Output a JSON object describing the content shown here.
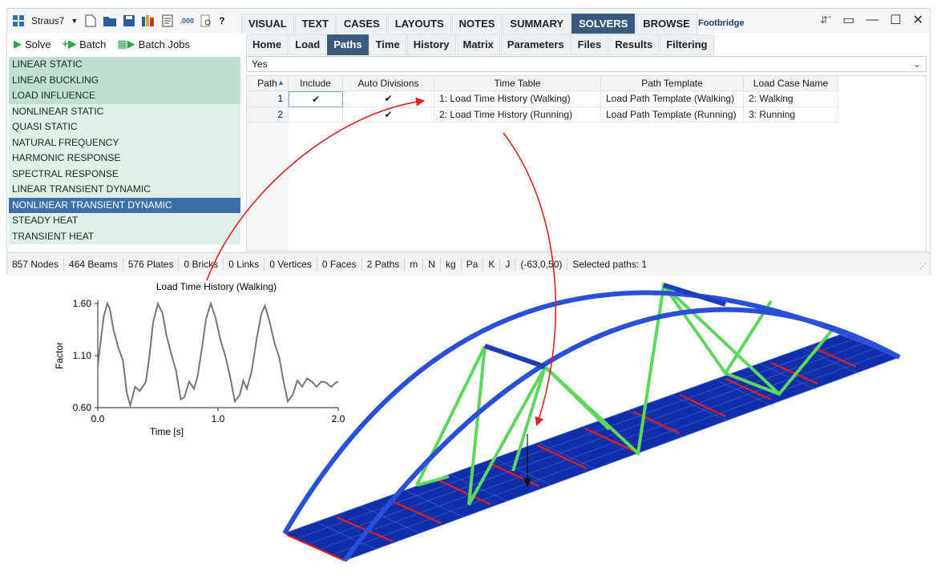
{
  "app": {
    "name": "Straus7",
    "model_title": "Footbridge"
  },
  "ribbon_tabs": [
    "VISUAL",
    "TEXT",
    "CASES",
    "LAYOUTS",
    "NOTES",
    "SUMMARY",
    "SOLVERS",
    "BROWSE"
  ],
  "ribbon_active": "SOLVERS",
  "toolbar": {
    "solve_label": "Solve",
    "batch_label": "Batch",
    "batch_jobs_label": "Batch Jobs"
  },
  "subtabs": [
    "Home",
    "Load",
    "Paths",
    "Time",
    "History",
    "Matrix",
    "Parameters",
    "Files",
    "Results",
    "Filtering"
  ],
  "subtab_active": "Paths",
  "solvers": [
    {
      "label": "LINEAR STATIC",
      "shade": "dark"
    },
    {
      "label": "LINEAR BUCKLING",
      "shade": "dark"
    },
    {
      "label": "LOAD INFLUENCE",
      "shade": "dark"
    },
    {
      "label": "NONLINEAR STATIC",
      "shade": "light"
    },
    {
      "label": "QUASI STATIC",
      "shade": "light"
    },
    {
      "label": "NATURAL FREQUENCY",
      "shade": "light"
    },
    {
      "label": "HARMONIC RESPONSE",
      "shade": "light"
    },
    {
      "label": "SPECTRAL RESPONSE",
      "shade": "light"
    },
    {
      "label": "LINEAR TRANSIENT DYNAMIC",
      "shade": "light"
    },
    {
      "label": "NONLINEAR TRANSIENT DYNAMIC",
      "shade": "selected"
    },
    {
      "label": "STEADY HEAT",
      "shade": "light"
    },
    {
      "label": "TRANSIENT HEAT",
      "shade": "light"
    }
  ],
  "dropdown_value": "Yes",
  "table": {
    "headers": [
      "Path",
      "Include",
      "Auto Divisions",
      "Time Table",
      "Path Template",
      "Load Case Name"
    ],
    "rows": [
      {
        "path": "1",
        "include": "✔",
        "auto": "✔",
        "time_table": "1: Load Time History (Walking)",
        "template": "Load Path Template (Walking)",
        "load_case": "2: Walking"
      },
      {
        "path": "2",
        "include": "",
        "auto": "✔",
        "time_table": "2: Load Time History (Running)",
        "template": "Load Path Template (Running)",
        "load_case": "3: Running"
      }
    ]
  },
  "status": [
    "857 Nodes",
    "464 Beams",
    "576 Plates",
    "0 Bricks",
    "0 Links",
    "0 Vertices",
    "0 Faces",
    "2 Paths",
    "m",
    "N",
    "kg",
    "Pa",
    "K",
    "J",
    "(-63,0,50)",
    "Selected paths: 1"
  ],
  "chart_data": {
    "type": "line",
    "title": "Load Time History (Walking)",
    "xlabel": "Time [s]",
    "ylabel": "Factor",
    "xlim": [
      0.0,
      2.0
    ],
    "ylim": [
      0.6,
      1.6
    ],
    "xticks": [
      "0.0",
      "1.0",
      "2.0"
    ],
    "yticks": [
      "1.60",
      "1.10",
      "0.60"
    ],
    "series": [
      {
        "color": "#777777",
        "x": [
          0.0,
          0.02,
          0.05,
          0.08,
          0.1,
          0.13,
          0.17,
          0.21,
          0.24,
          0.27,
          0.31,
          0.35,
          0.4,
          0.43,
          0.46,
          0.5,
          0.54,
          0.57,
          0.61,
          0.65,
          0.69,
          0.72,
          0.76,
          0.8,
          0.83,
          0.87,
          0.9,
          0.94,
          0.98,
          1.02,
          1.06,
          1.1,
          1.14,
          1.18,
          1.21,
          1.24,
          1.28,
          1.32,
          1.36,
          1.39,
          1.43,
          1.47,
          1.51,
          1.54,
          1.58,
          1.62,
          1.66,
          1.7,
          1.74,
          1.78,
          1.82,
          1.86,
          1.9,
          1.94,
          1.98,
          2.0
        ],
        "y": [
          1.0,
          1.2,
          1.48,
          1.6,
          1.55,
          1.35,
          1.18,
          1.05,
          0.75,
          0.62,
          0.8,
          0.76,
          0.85,
          1.1,
          1.42,
          1.6,
          1.5,
          1.3,
          1.12,
          0.96,
          0.68,
          0.7,
          0.85,
          0.78,
          0.9,
          1.2,
          1.45,
          1.6,
          1.46,
          1.25,
          1.1,
          0.9,
          0.66,
          0.72,
          0.86,
          0.78,
          0.95,
          1.25,
          1.5,
          1.58,
          1.42,
          1.22,
          1.08,
          0.88,
          0.66,
          0.72,
          0.86,
          0.8,
          0.88,
          0.85,
          0.8,
          0.85,
          0.84,
          0.8,
          0.84,
          0.85
        ]
      }
    ]
  }
}
